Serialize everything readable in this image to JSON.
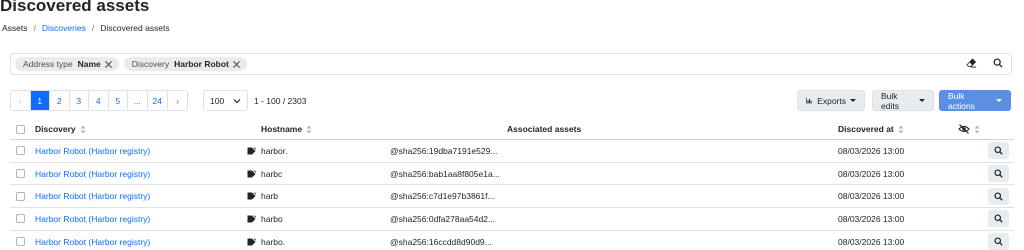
{
  "page": {
    "title": "Discovered assets",
    "breadcrumb": [
      "Assets",
      "Discoveries",
      "Discovered assets"
    ]
  },
  "filters": [
    {
      "key": "Address type",
      "value": "Name"
    },
    {
      "key": "Discovery",
      "value": "Harbor Robot"
    }
  ],
  "pagination": {
    "prev": "‹",
    "pages": [
      "1",
      "2",
      "3",
      "4",
      "5",
      "...",
      "24"
    ],
    "next": "›",
    "current": "1",
    "per_page": "100",
    "range": "1 - 100 / 2303"
  },
  "toolbar": {
    "exports_label": "Exports",
    "bulk_edits_label": "Bulk edits",
    "bulk_actions_label": "Bulk actions"
  },
  "table": {
    "columns": {
      "discovery": "Discovery",
      "hostname": "Hostname",
      "associated_assets": "Associated assets",
      "discovered_at": "Discovered at"
    },
    "rows": [
      {
        "discovery": "Harbor Robot (Harbor registry)",
        "hostname": "harbor.",
        "asset": "@sha256:19dba7191e529...",
        "discovered_at": "08/03/2026 13:00"
      },
      {
        "discovery": "Harbor Robot (Harbor registry)",
        "hostname": "harbc",
        "asset": "@sha256:bab1aa8f805e1a...",
        "discovered_at": "08/03/2026 13:00"
      },
      {
        "discovery": "Harbor Robot (Harbor registry)",
        "hostname": "harb",
        "asset": "@sha256:c7d1e97b3861f...",
        "discovered_at": "08/03/2026 13:00"
      },
      {
        "discovery": "Harbor Robot (Harbor registry)",
        "hostname": "harbo",
        "asset": "@sha256:0dfa278aa54d2...",
        "discovered_at": "08/03/2026 13:00"
      },
      {
        "discovery": "Harbor Robot (Harbor registry)",
        "hostname": "harbo.",
        "asset": "@sha256:16ccdd8d90d9...",
        "discovered_at": "08/03/2026 13:00"
      }
    ]
  },
  "icons": {
    "clear_filters": "eraser-icon",
    "search": "search-icon",
    "hidden_columns": "eye-slash-icon",
    "tag": "tag-icon",
    "row_action": "search-icon"
  },
  "colors": {
    "primary": "#0d6efd",
    "bulk_actions_bg": "#5b8fe3",
    "chip_bg": "#e9ecef"
  }
}
